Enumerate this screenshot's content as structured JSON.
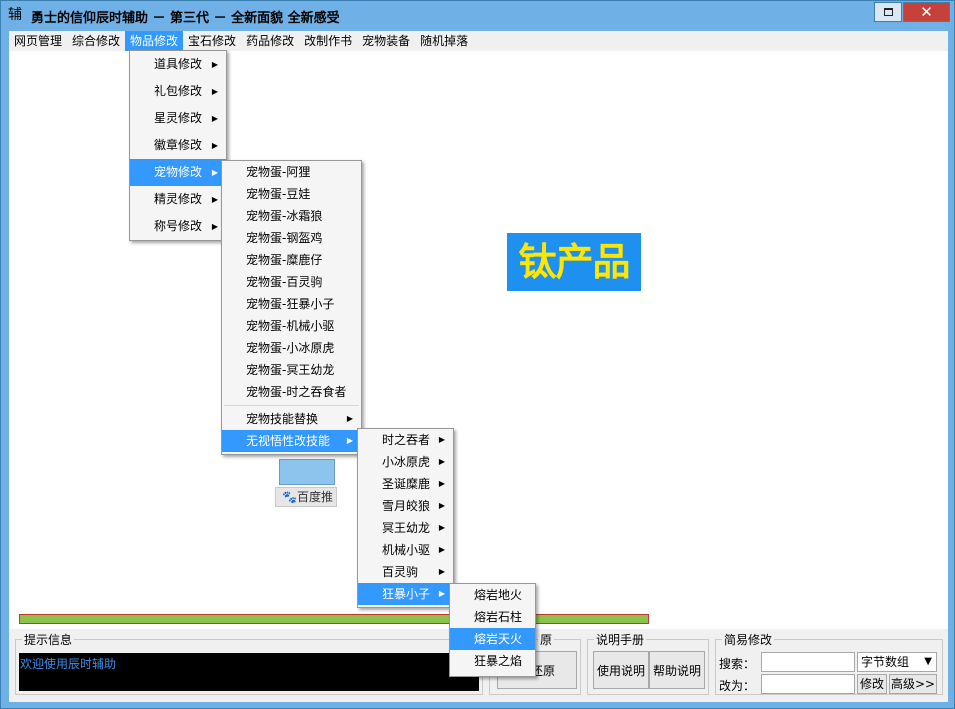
{
  "window": {
    "title": "勇士的信仰辰时辅助 － 第三代 － 全新面貌 全新感受",
    "icon_char": "辅",
    "close_glyph": "✕"
  },
  "menubar": [
    "网页管理",
    "综合修改",
    "物品修改",
    "宝石修改",
    "药品修改",
    "改制作书",
    "宠物装备",
    "随机掉落"
  ],
  "menu_item_arrow": "▶",
  "menu_level1": [
    "道具修改",
    "礼包修改",
    "星灵修改",
    "徽章修改",
    "宠物修改",
    "精灵修改",
    "称号修改"
  ],
  "menu_level2": {
    "eggs": [
      "宠物蛋-阿狸",
      "宠物蛋-豆娃",
      "宠物蛋-冰霜狼",
      "宠物蛋-钢盔鸡",
      "宠物蛋-糜鹿仔",
      "宠物蛋-百灵驹",
      "宠物蛋-狂暴小子",
      "宠物蛋-机械小驱",
      "宠物蛋-小冰原虎",
      "宠物蛋-冥王幼龙",
      "宠物蛋-时之吞食者"
    ],
    "skills": [
      "宠物技能替换",
      "无视悟性改技能"
    ]
  },
  "menu_level3": [
    "时之吞者",
    "小冰原虎",
    "圣诞糜鹿",
    "雪月皎狼",
    "冥王幼龙",
    "机械小驱",
    "百灵驹",
    "狂暴小子"
  ],
  "menu_level4": [
    "熔岩地火",
    "熔岩石柱",
    "熔岩天火",
    "狂暴之焰"
  ],
  "content": {
    "logo_text": "钛产品",
    "baidu_label": "百度推",
    "baidu_icon": "🐾",
    "progress": 1.0
  },
  "bottom": {
    "tips_title": "提示信息",
    "tips_text": "欢迎使用辰时辅助",
    "restore_title_partial": "原",
    "restore_button_partial": "鱼还原",
    "manual_title": "说明手册",
    "usage_button": "使用说明",
    "help_button": "帮助说明",
    "quick_title": "简易修改",
    "search_label": "搜索：",
    "change_label": "改为：",
    "type_select": "字节数组",
    "modify_button": "修改",
    "advanced_button": "高级>>"
  },
  "colors": {
    "title_bg": "#6fb0e6",
    "highlight": "#3399ff",
    "close_button": "#c7403a",
    "progress_fill": "#8bc34a",
    "logo_bg": "#1e90f0",
    "logo_text": "#ffe600"
  }
}
